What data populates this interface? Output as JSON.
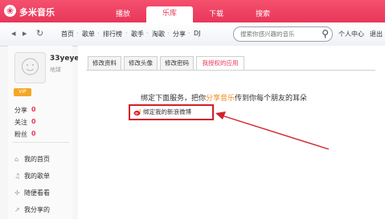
{
  "app": {
    "title": "多米音乐",
    "logo_glyph": "❀"
  },
  "nav": {
    "tabs": [
      {
        "label": "播放",
        "active": false
      },
      {
        "label": "乐库",
        "active": true
      },
      {
        "label": "下载",
        "active": false
      },
      {
        "label": "搜索",
        "active": false
      }
    ]
  },
  "toolbar": {
    "icons": {
      "back": "◂",
      "forward": "▸",
      "refresh": "↻"
    },
    "breadcrumbs": [
      "首页",
      "歌单",
      "排行榜",
      "歌手",
      "淘歌",
      "分享",
      "DJ"
    ],
    "separator": "·",
    "search": {
      "placeholder": "搜索你感兴趣的音乐",
      "icon": "search-icon"
    },
    "user_center": "个人中心",
    "logout": "退出"
  },
  "profile": {
    "username": "33yeye",
    "location": "地球",
    "vip_badge": "VIP",
    "stats": [
      {
        "label": "分享",
        "value": "0"
      },
      {
        "label": "关注",
        "value": "0"
      },
      {
        "label": "粉丝",
        "value": "0"
      }
    ],
    "menu": [
      {
        "label": "我的首页",
        "icon": "home-icon"
      },
      {
        "label": "我的歌单",
        "icon": "playlist-icon"
      },
      {
        "label": "随便看看",
        "icon": "browse-icon"
      },
      {
        "label": "我分享的",
        "icon": "share-icon"
      }
    ]
  },
  "content": {
    "tabs": [
      {
        "label": "修改资料",
        "active": false
      },
      {
        "label": "修改头像",
        "active": false
      },
      {
        "label": "修改密码",
        "active": false
      },
      {
        "label": "我授权的应用",
        "active": true
      }
    ],
    "promo_prefix": "绑定下面服务，把你",
    "promo_accent": "分享音乐",
    "promo_suffix": "传到你每个朋友的耳朵",
    "bind_button": "绑定我的新浪微博"
  },
  "colors": {
    "brand": "#e8375a",
    "accent": "#f5891e",
    "annotation": "#d0202a"
  }
}
